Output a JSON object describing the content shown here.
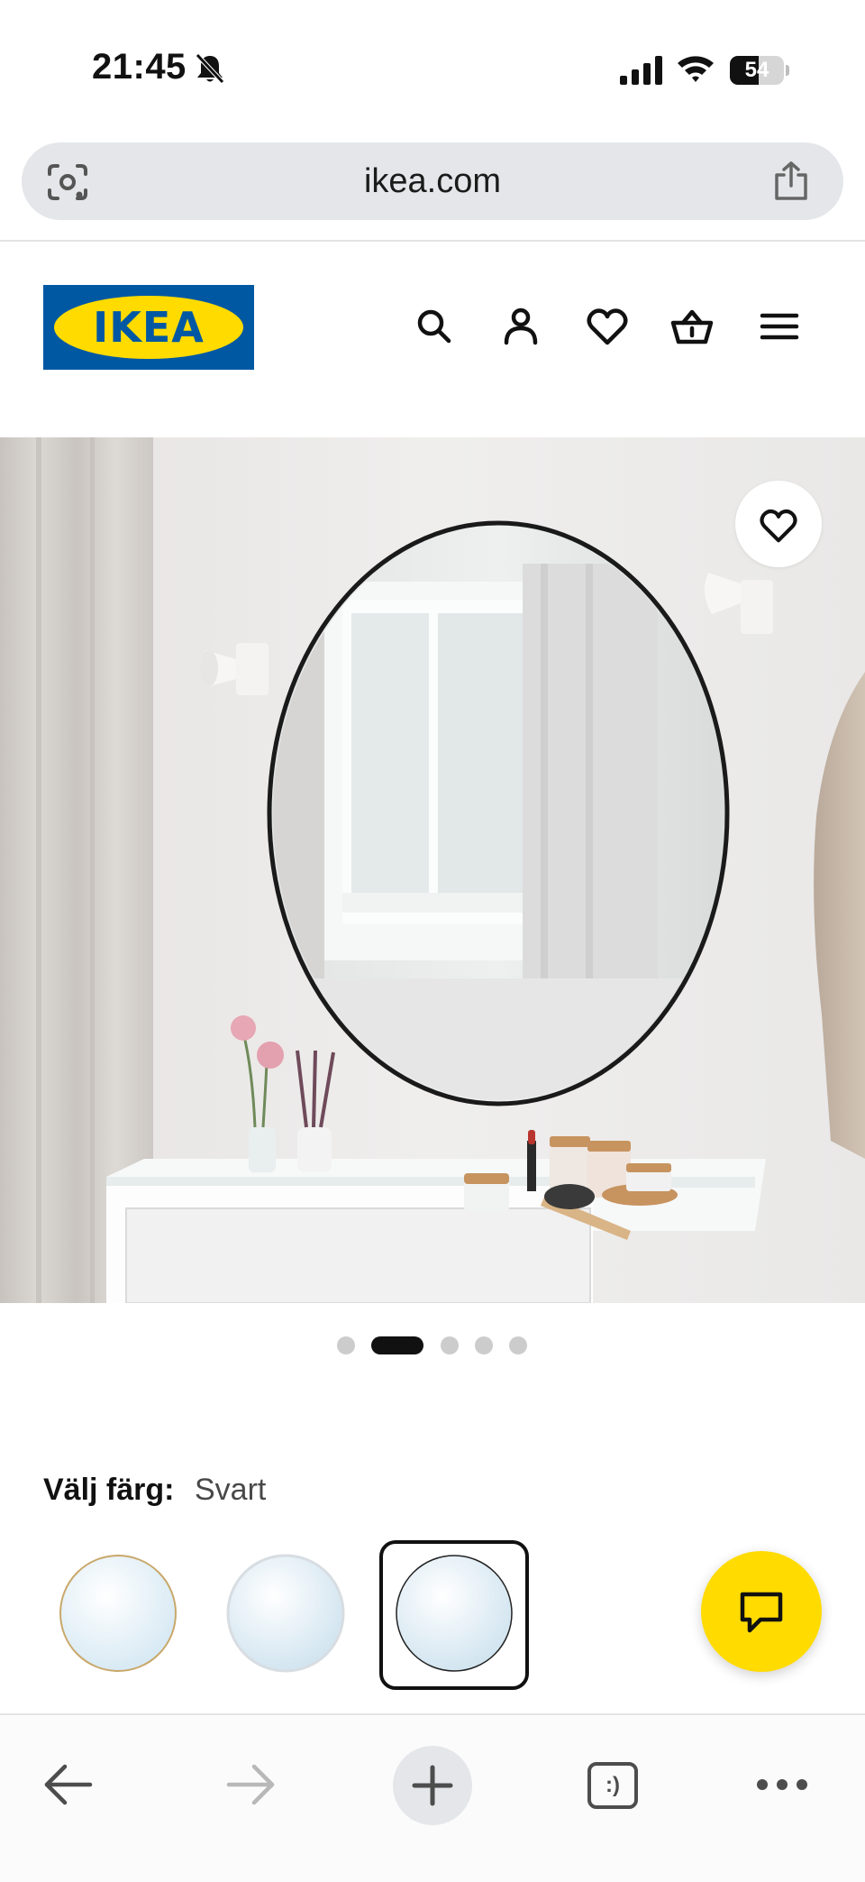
{
  "status_bar": {
    "time": "21:45",
    "battery_level": "54",
    "icons": [
      "bell-slash-icon",
      "cellular-signal-icon",
      "wifi-icon",
      "battery-icon"
    ]
  },
  "browser": {
    "url": "ikea.com",
    "icons": [
      "camera-lens-icon",
      "share-icon"
    ]
  },
  "header": {
    "logo_text": "IKEA",
    "icons": [
      "search-icon",
      "account-icon",
      "wishlist-heart-icon",
      "shopping-basket-icon",
      "menu-icon"
    ],
    "brand_colors": {
      "blue": "#0058a3",
      "yellow": "#ffdb00"
    }
  },
  "product": {
    "favorite_icon": "heart-outline-icon",
    "carousel": {
      "total": 5,
      "active": 2
    }
  },
  "color_picker": {
    "label": "Välj färg:",
    "selected": "Svart",
    "swatches": [
      {
        "frame_color": "#c9a86a",
        "selected": false
      },
      {
        "frame_color": "#d7dde2",
        "selected": false
      },
      {
        "frame_color": "#222222",
        "selected": true
      }
    ]
  },
  "chat": {
    "icon": "chat-bubble-icon",
    "color": "#ffdb00"
  },
  "toolbar": {
    "back_icon": "arrow-left-icon",
    "forward_icon": "arrow-right-icon",
    "new_tab_icon": "plus-icon",
    "tabs_label": ":)",
    "more_icon": "more-dots-icon"
  }
}
